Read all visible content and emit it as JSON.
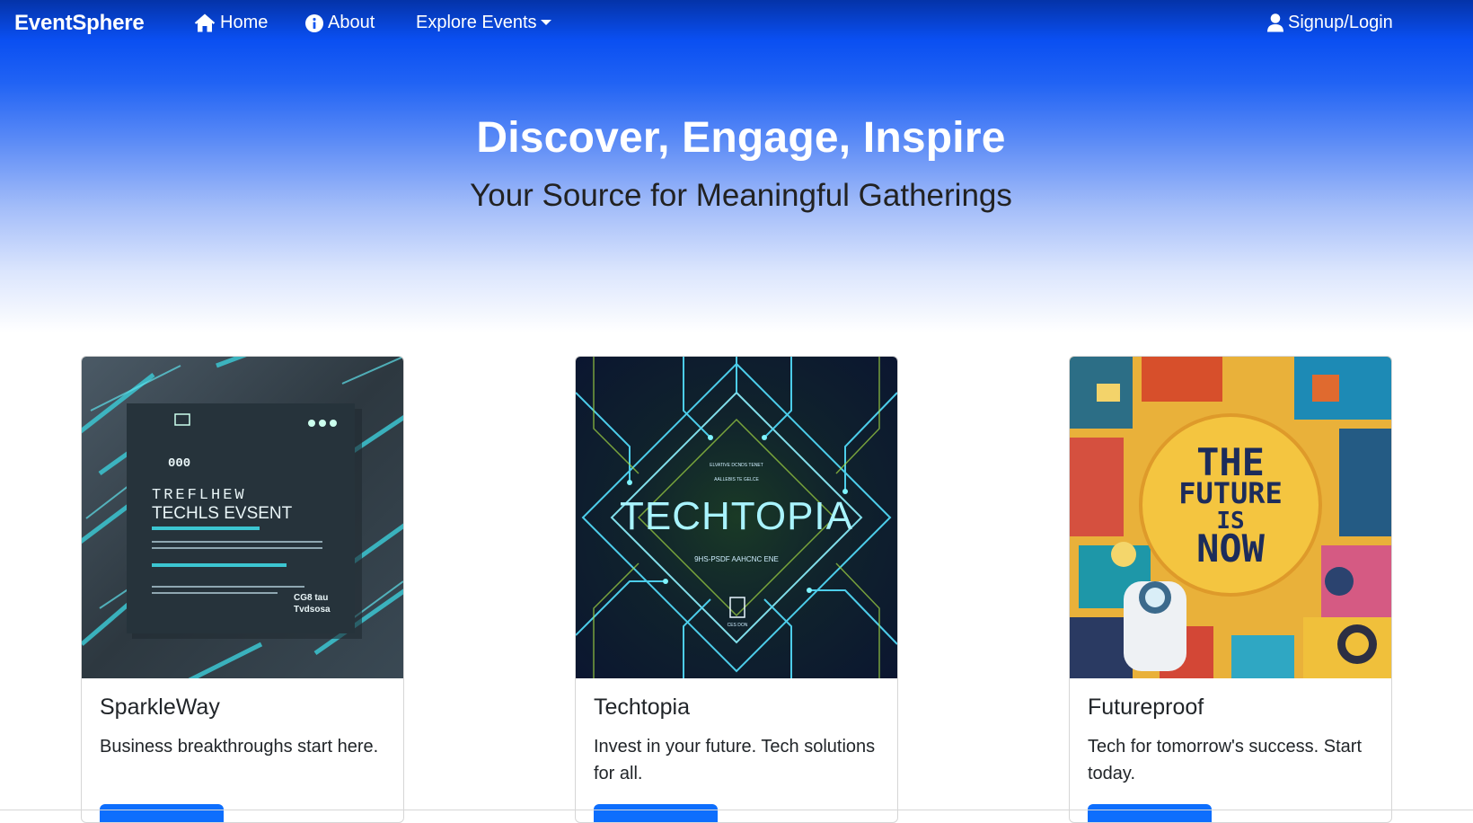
{
  "navbar": {
    "brand": "EventSphere",
    "items": [
      {
        "label": "Home",
        "icon": "home-icon"
      },
      {
        "label": "About",
        "icon": "info-circle-icon"
      },
      {
        "label": "Explore Events",
        "icon": "chevron-down-icon"
      }
    ],
    "login_label": "Signup/Login",
    "login_icon": "user-icon"
  },
  "hero": {
    "title": "Discover, Engage, Inspire",
    "subtitle": "Your Source for Meaningful Gatherings"
  },
  "cards": [
    {
      "title": "SparkleWay",
      "text": "Business breakthroughs start here.",
      "poster": {
        "counter": "000",
        "line1": "TREFLHEW",
        "line2": "TECHLS EVSENT",
        "corner1": "CG8 tau",
        "corner2": "Tvdsosa"
      }
    },
    {
      "title": "Techtopia",
      "text": "Invest in your future. Tech solutions for all.",
      "poster": {
        "headline": "TECHTOPIA",
        "top1": "ELVATIVE DCNDS TENET",
        "top2": "AALLEBIS TE GELCE",
        "subline": "9HS-PSDF AAHCNC ENE",
        "footer": "CES DON"
      }
    },
    {
      "title": "Futureproof",
      "text": "Tech for tomorrow's success. Start today.",
      "poster": {
        "line1": "THE",
        "line2": "FUTURE",
        "line3": "IS",
        "line4": "NOW"
      }
    }
  ],
  "colors": {
    "primary": "#0d6efd",
    "hero_top": "#0433a8",
    "hero_mid": "#2163f4"
  }
}
